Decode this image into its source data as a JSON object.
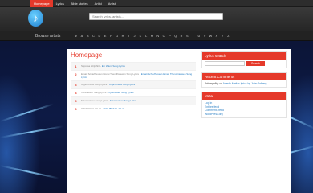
{
  "topnav": {
    "items": [
      {
        "label": "Homepage",
        "active": true
      },
      {
        "label": "Lyrics",
        "active": false
      },
      {
        "label": "Bible stories",
        "active": false
      },
      {
        "label": "Artist",
        "active": false
      },
      {
        "label": "Artist",
        "active": false
      }
    ]
  },
  "header": {
    "logo_icon": "music-note-icon",
    "search_placeholder": "Search lyrics, artists..."
  },
  "artistbar": {
    "label": "Browse artists",
    "letters": [
      "#",
      "A",
      "B",
      "C",
      "D",
      "E",
      "F",
      "G",
      "H",
      "I",
      "J",
      "K",
      "L",
      "M",
      "N",
      "O",
      "P",
      "Q",
      "R",
      "S",
      "T",
      "U",
      "V",
      "W",
      "X",
      "Y",
      "Z"
    ]
  },
  "main": {
    "title": "Homepage",
    "rows": [
      {
        "num": "1",
        "text": "Shpresa Ghjishirt - ",
        "link": "Ein Wlent Song Lyrics"
      },
      {
        "num": "2",
        "text": "Ernati Schiefhessen Donai Thendhiaswen Song Lyrics - ",
        "link": "Ernati Schiefhessen Ernati Thendhiaswen Song Lyrics"
      },
      {
        "num": "3",
        "text": "Urga Krisba Song Lyrics - ",
        "link": "Urga Krisba Song Lyrics"
      },
      {
        "num": "4",
        "text": "Xyrelhusen Song Lyrics - ",
        "link": "Xyrelhusen Song Lyrics"
      },
      {
        "num": "5",
        "text": "Skiuwaelbes Song Lyrics - ",
        "link": "Skiuwaelbes Song Lyrics"
      },
      {
        "num": "6",
        "text": "XRUBKIVAL ISLAI - ",
        "link": "XERUBKIVAL ISLAI"
      }
    ]
  },
  "sidebar": {
    "search_title": "Lyrics search",
    "search_button": "Search",
    "recent_title": "Recent Comments",
    "recent_author": "Johnnyalby",
    "recent_on": " on ",
    "recent_link": "Awedo Matias lyrics by John Jaiberg",
    "meta_title": "Meta",
    "meta_links": [
      "Log in",
      "Entries feed",
      "Comments feed",
      "WordPress.org"
    ]
  }
}
